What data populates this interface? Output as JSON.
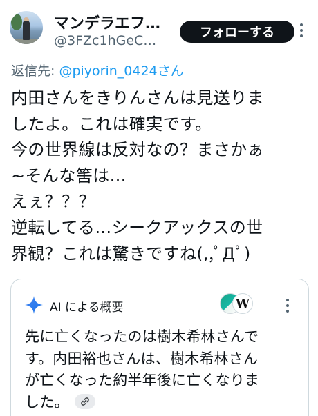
{
  "header": {
    "display_name": "マンデラエフ…",
    "handle": "@3FZc1hGeC…",
    "follow_label": "フォローする"
  },
  "reply": {
    "prefix": "返信先: ",
    "mention": "@piyorin_0424さん"
  },
  "tweet": {
    "lines": [
      "内田さんをきりんさんは見送りま",
      "したよ。これは確実です。",
      "今の世界線は反対なの？まさかぁ",
      "~そんな筈は…",
      "えぇ？？？",
      "逆転してる…シークアックスの世",
      "界観？これは驚きですね(,,ﾟДﾟ)"
    ]
  },
  "ai_overview": {
    "label": "AI による概要",
    "source_w": "W",
    "lines": [
      "先に亡くなったのは樹木希林さんで",
      "す。内田裕也さんは、樹木希林さん",
      "が亡くなった約半年後に亡くなりま",
      "した。"
    ]
  },
  "icons": {
    "avatar": "profile-photo",
    "more": "more-vertical-icon",
    "sparkle": "ai-sparkle-icon",
    "link": "link-icon"
  },
  "colors": {
    "accent": "#1d9bf0",
    "text": "#0f1419",
    "secondary": "#536471",
    "follow_bg": "#0f1419"
  }
}
